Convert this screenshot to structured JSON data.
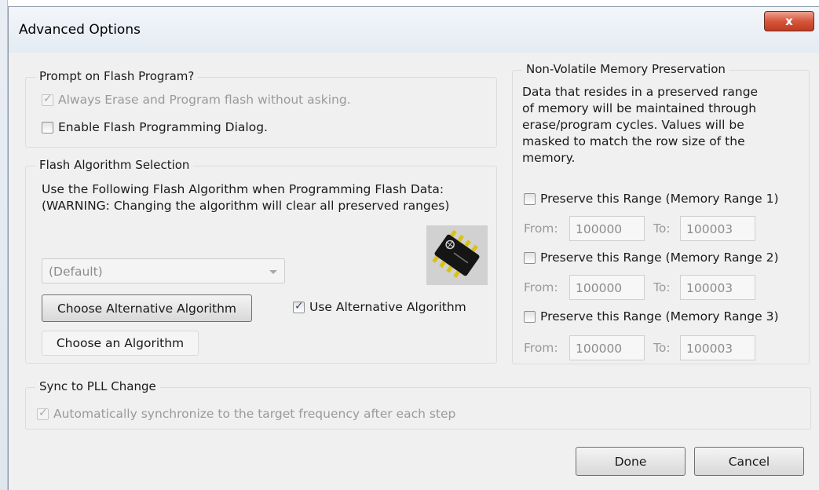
{
  "window": {
    "title": "Advanced Options",
    "close_glyph": "x"
  },
  "prompt_group": {
    "legend": "Prompt on Flash Program?",
    "always_erase": {
      "label": "Always Erase and Program flash without asking.",
      "checked": true,
      "disabled": true
    },
    "enable_dialog": {
      "label": "Enable Flash Programming Dialog.",
      "checked": false
    }
  },
  "algorithm_group": {
    "legend": "Flash Algorithm Selection",
    "description_line1": "Use the Following Flash Algorithm when Programming Flash Data:",
    "description_line2": "(WARNING: Changing the algorithm will clear all preserved ranges)",
    "algorithm_select": {
      "value": "(Default)"
    },
    "choose_alternative_label": "Choose Alternative Algorithm",
    "use_alternative": {
      "label": "Use Alternative Algorithm",
      "checked": true
    },
    "choose_algorithm_label": "Choose an Algorithm",
    "chip_icon": "ic-chip-icon"
  },
  "nvm_group": {
    "legend": "Non-Volatile Memory Preservation",
    "description_lines": [
      "Data that resides in a preserved range",
      "of memory will be maintained through",
      "erase/program cycles. Values will be",
      "masked to match the row size of the",
      "memory."
    ],
    "ranges": [
      {
        "label": "Preserve this Range (Memory Range 1)",
        "checked": false,
        "from_label": "From:",
        "from_value": "100000",
        "to_label": "To:",
        "to_value": "100003"
      },
      {
        "label": "Preserve this Range (Memory Range 2)",
        "checked": false,
        "from_label": "From:",
        "from_value": "100000",
        "to_label": "To:",
        "to_value": "100003"
      },
      {
        "label": "Preserve this Range (Memory Range 3)",
        "checked": false,
        "from_label": "From:",
        "from_value": "100000",
        "to_label": "To:",
        "to_value": "100003"
      }
    ]
  },
  "pll_group": {
    "legend": "Sync to PLL Change",
    "auto_sync": {
      "label": "Automatically synchronize to the target frequency after each step",
      "checked": true,
      "disabled": true
    }
  },
  "footer": {
    "done_label": "Done",
    "cancel_label": "Cancel"
  }
}
